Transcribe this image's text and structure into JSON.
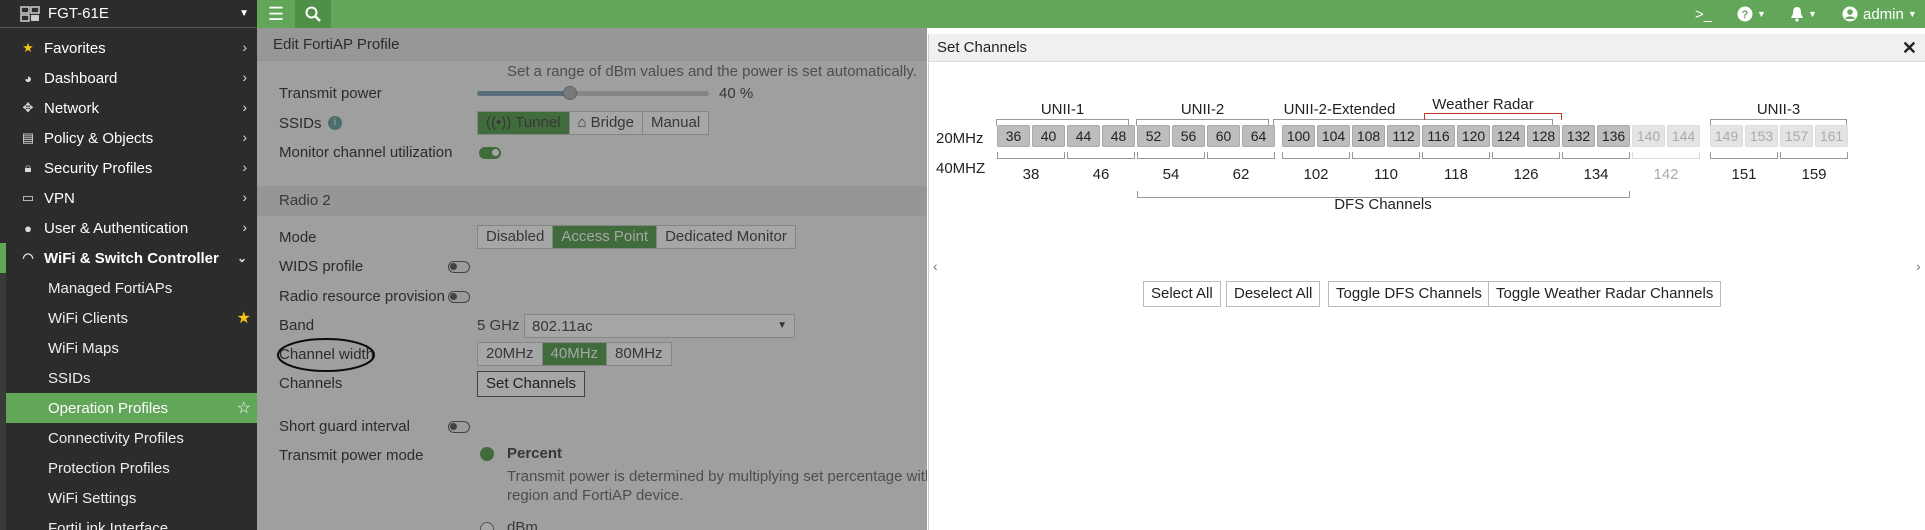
{
  "sidebar": {
    "device": "FGT-61E",
    "items": [
      {
        "label": "Favorites",
        "icon": "star-icon"
      },
      {
        "label": "Dashboard",
        "icon": "dashboard-icon"
      },
      {
        "label": "Network",
        "icon": "network-icon"
      },
      {
        "label": "Policy & Objects",
        "icon": "document-icon"
      },
      {
        "label": "Security Profiles",
        "icon": "lock-icon"
      },
      {
        "label": "VPN",
        "icon": "laptop-icon"
      },
      {
        "label": "User & Authentication",
        "icon": "user-icon"
      },
      {
        "label": "WiFi & Switch Controller",
        "icon": "wifi-icon"
      }
    ],
    "subitems": [
      {
        "label": "Managed FortiAPs"
      },
      {
        "label": "WiFi Clients"
      },
      {
        "label": "WiFi Maps"
      },
      {
        "label": "SSIDs"
      },
      {
        "label": "Operation Profiles"
      },
      {
        "label": "Connectivity Profiles"
      },
      {
        "label": "Protection Profiles"
      },
      {
        "label": "WiFi Settings"
      },
      {
        "label": "FortiLink Interface"
      }
    ]
  },
  "topbar": {
    "user": "admin"
  },
  "page": {
    "title": "Edit FortiAP Profile",
    "hint": "Set a range of dBm values and the power is set automatically.",
    "transmit_power_label": "Transmit power",
    "transmit_power_value": "40 %",
    "transmit_power_fraction": 0.4,
    "ssids_label": "SSIDs",
    "ssid_modes": [
      "Tunnel",
      "Bridge",
      "Manual"
    ],
    "monitor_label": "Monitor channel utilization",
    "radio2": "Radio 2",
    "mode_label": "Mode",
    "modes": [
      "Disabled",
      "Access Point",
      "Dedicated Monitor"
    ],
    "wids_label": "WIDS profile",
    "rrp_label": "Radio resource provision",
    "band_label": "Band",
    "band_prefix": "5 GHz",
    "band_value": "802.11ac",
    "cw_label": "Channel width",
    "widths": [
      "20MHz",
      "40MHz",
      "80MHz"
    ],
    "channels_label": "Channels",
    "set_channels_btn": "Set Channels",
    "sgi_label": "Short guard interval",
    "tpm_label": "Transmit power mode",
    "percent_label": "Percent",
    "percent_desc_1": "Transmit power is determined by multiplying set percentage with",
    "percent_desc_2": "region and FortiAP device.",
    "dbm_label": "dBm"
  },
  "modal": {
    "title": "Set Channels",
    "groups": {
      "unii1": "UNII-1",
      "unii2": "UNII-2",
      "unii2e": "UNII-2-Extended",
      "weather": "Weather Radar",
      "unii3": "UNII-3",
      "dfs": "DFS Channels"
    },
    "row20": "20MHz",
    "row40": "40MHZ",
    "channels20": [
      {
        "n": "36"
      },
      {
        "n": "40"
      },
      {
        "n": "44"
      },
      {
        "n": "48"
      },
      {
        "n": "52"
      },
      {
        "n": "56"
      },
      {
        "n": "60"
      },
      {
        "n": "64"
      },
      {
        "n": "100"
      },
      {
        "n": "104"
      },
      {
        "n": "108"
      },
      {
        "n": "112"
      },
      {
        "n": "116"
      },
      {
        "n": "120"
      },
      {
        "n": "124"
      },
      {
        "n": "128"
      },
      {
        "n": "132"
      },
      {
        "n": "136"
      },
      {
        "n": "140"
      },
      {
        "n": "144"
      },
      {
        "n": "149"
      },
      {
        "n": "153"
      },
      {
        "n": "157"
      },
      {
        "n": "161"
      }
    ],
    "channels40": [
      "38",
      "46",
      "54",
      "62",
      "102",
      "110",
      "118",
      "126",
      "134",
      "142",
      "151",
      "159"
    ],
    "buttons": {
      "select_all": "Select All",
      "deselect_all": "Deselect All",
      "toggle_dfs": "Toggle DFS Channels",
      "toggle_weather": "Toggle Weather Radar Channels"
    }
  }
}
